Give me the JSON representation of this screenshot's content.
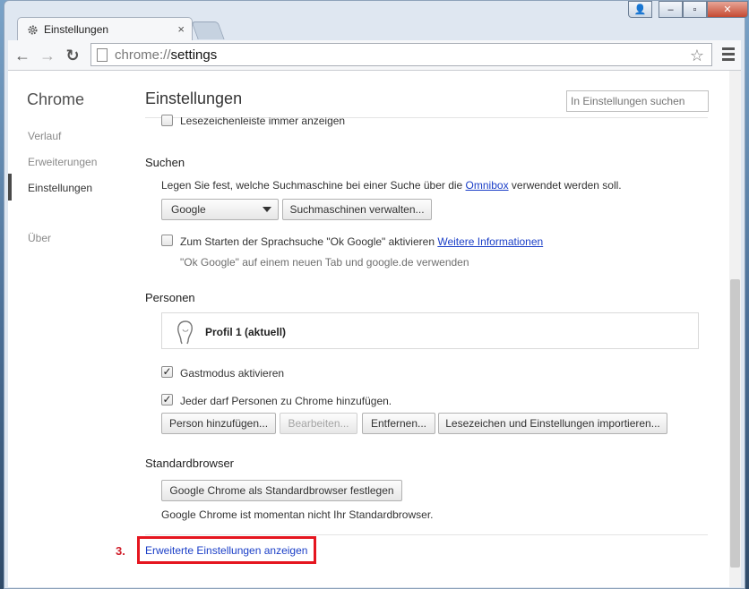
{
  "window": {
    "tab_title": "Einstellungen",
    "tab_close": "×",
    "controls": {
      "user": "👤",
      "minimize": "–",
      "maximize": "▫",
      "close": "✕"
    }
  },
  "toolbar": {
    "url_scheme": "chrome://",
    "url_host": "settings",
    "back": "←",
    "forward": "→",
    "reload": "↻",
    "star": "☆"
  },
  "sidebar": {
    "title": "Chrome",
    "items": [
      {
        "label": "Verlauf"
      },
      {
        "label": "Erweiterungen"
      },
      {
        "label": "Einstellungen"
      },
      {
        "label": "Über"
      }
    ]
  },
  "main": {
    "title": "Einstellungen",
    "search_placeholder": "In Einstellungen suchen",
    "bookmarks_bar_label": "Lesezeichenleiste immer anzeigen"
  },
  "search_section": {
    "title": "Suchen",
    "desc_before": "Legen Sie fest, welche Suchmaschine bei einer Suche über die ",
    "desc_link": "Omnibox",
    "desc_after": " verwendet werden soll.",
    "engine_selected": "Google",
    "manage_button": "Suchmaschinen verwalten...",
    "ok_google_label": "Zum Starten der Sprachsuche \"Ok Google\" aktivieren",
    "ok_google_link": "Weitere Informationen",
    "ok_google_hint": "\"Ok Google\" auf einem neuen Tab und google.de verwenden",
    "ok_google_checked": false
  },
  "people_section": {
    "title": "Personen",
    "profile_name": "Profil 1 (aktuell)",
    "guest_mode_label": "Gastmodus aktivieren",
    "guest_mode_checked": true,
    "anyone_add_label": "Jeder darf Personen zu Chrome hinzufügen.",
    "anyone_add_checked": true,
    "check_mark": "✓",
    "buttons": {
      "add": "Person hinzufügen...",
      "edit": "Bearbeiten...",
      "remove": "Entfernen...",
      "import": "Lesezeichen und Einstellungen importieren..."
    }
  },
  "default_browser_section": {
    "title": "Standardbrowser",
    "set_default_button": "Google Chrome als Standardbrowser festlegen",
    "status": "Google Chrome ist momentan nicht Ihr Standardbrowser."
  },
  "advanced_link": "Erweiterte Einstellungen anzeigen",
  "annotation": {
    "step_label": "3.",
    "highlight_color": "#e5151f"
  },
  "colors": {
    "link": "#1a3ec7",
    "step": "#d01e2a"
  }
}
